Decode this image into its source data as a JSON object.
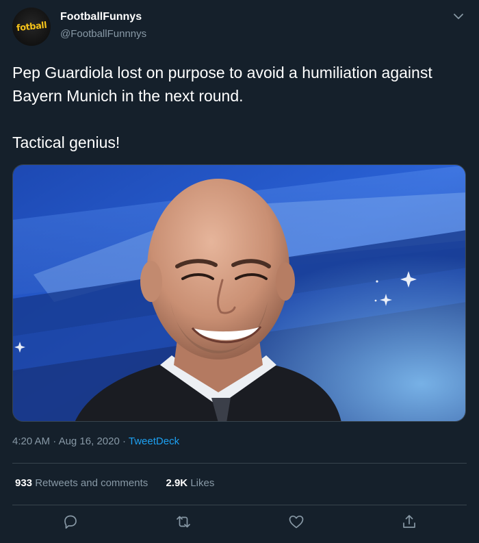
{
  "user": {
    "display_name": "FootballFunnys",
    "handle": "@FootballFunnnys",
    "avatar_text": "fotball"
  },
  "tweet": {
    "text_line_1": "Pep Guardiola lost on purpose to avoid a humiliation against Bayern Munich in the next round.",
    "text_line_2": "Tactical genius!",
    "time": "4:20 AM",
    "date": "Aug 16, 2020",
    "source": "TweetDeck",
    "separator": "·"
  },
  "stats": {
    "retweets_count": "933",
    "retweets_label": "Retweets and comments",
    "likes_count": "2.9K",
    "likes_label": "Likes"
  },
  "icons": {
    "caret": "chevron-down-icon",
    "reply": "reply-icon",
    "retweet": "retweet-icon",
    "like": "heart-icon",
    "share": "share-icon"
  },
  "colors": {
    "background": "#15202b",
    "text_primary": "#ffffff",
    "text_secondary": "#8899a6",
    "link": "#1da1f2",
    "border": "#38444d"
  }
}
